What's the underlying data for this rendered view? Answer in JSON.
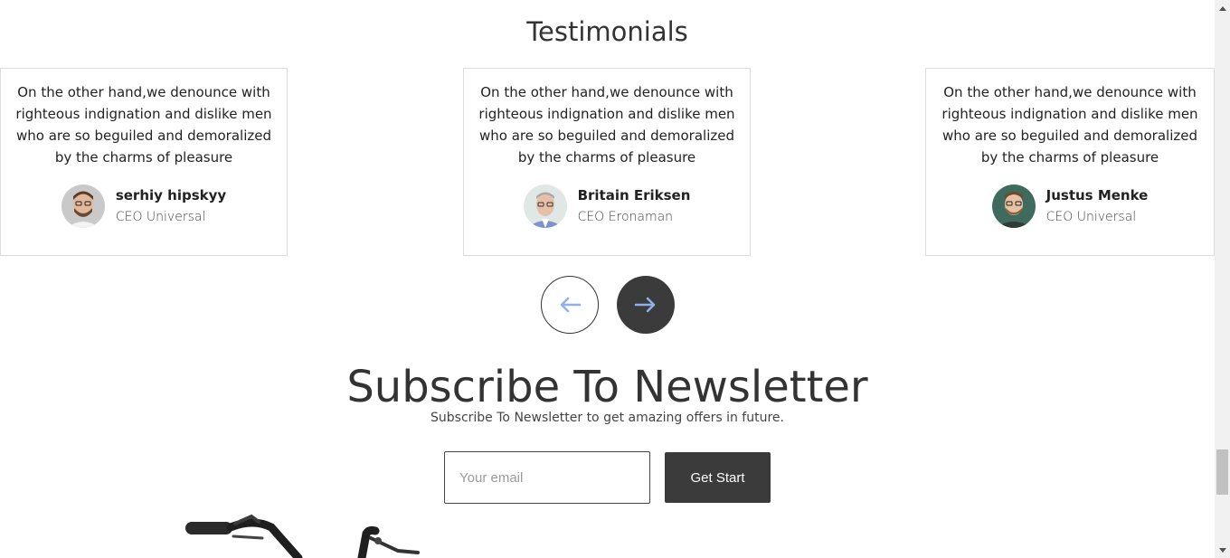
{
  "testimonials": {
    "title": "Testimonials",
    "cards": [
      {
        "quote": "On the other hand,we denounce with righteous indignation and dislike men who are so beguiled and demoralized by the charms of pleasure",
        "name": "serhiy hipskyy",
        "role": "CEO Universal"
      },
      {
        "quote": "On the other hand,we denounce with righteous indignation and dislike men who are so beguiled and demoralized by the charms of pleasure",
        "name": "Britain Eriksen",
        "role": "CEO Eronaman"
      },
      {
        "quote": "On the other hand,we denounce with righteous indignation and dislike men who are so beguiled and demoralized by the charms of pleasure",
        "name": "Justus Menke",
        "role": "CEO Universal"
      }
    ],
    "nav": {
      "prev_icon": "arrow-left-icon",
      "next_icon": "arrow-right-icon"
    }
  },
  "newsletter": {
    "title": "Subscribe To Newsletter",
    "subtitle": "Subscribe To Newsletter to get amazing offers in future.",
    "email_placeholder": "Your email",
    "button_label": "Get Start"
  },
  "colors": {
    "dark_button": "#3b3b3b",
    "arrow_accent": "#8fb0ea",
    "card_border": "#dcdcdc"
  }
}
